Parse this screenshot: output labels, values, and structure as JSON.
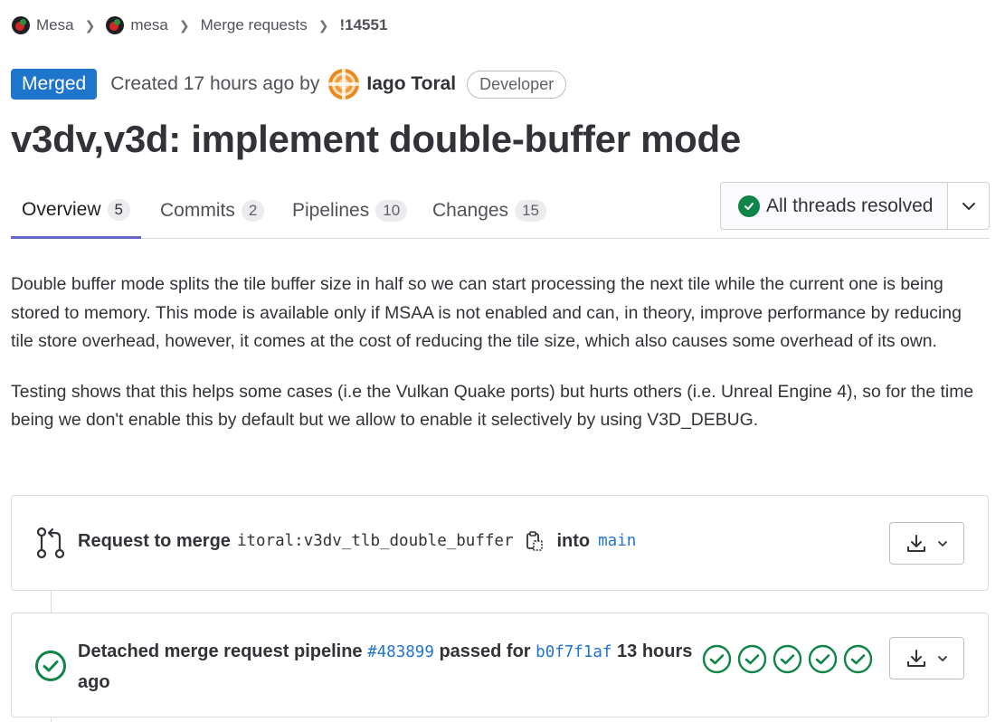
{
  "breadcrumb": {
    "items": [
      "Mesa",
      "mesa",
      "Merge requests"
    ],
    "current": "!14551"
  },
  "header": {
    "status": "Merged",
    "created_text": "Created 17 hours ago by",
    "author": "Iago Toral",
    "role": "Developer"
  },
  "title": "v3dv,v3d: implement double-buffer mode",
  "tabs": [
    {
      "label": "Overview",
      "count": "5"
    },
    {
      "label": "Commits",
      "count": "2"
    },
    {
      "label": "Pipelines",
      "count": "10"
    },
    {
      "label": "Changes",
      "count": "15"
    }
  ],
  "threads": {
    "label": "All threads resolved"
  },
  "description": {
    "p1": "Double buffer mode splits the tile buffer size in half so we can start processing the next tile while the current one is being stored to memory. This mode is available only if MSAA is not enabled and can, in theory, improve performance by reducing tile store overhead, however, it comes at the cost of reducing the tile size, which also causes some overhead of its own.",
    "p2": "Testing shows that this helps some cases (i.e the Vulkan Quake ports) but hurts others (i.e. Unreal Engine 4), so for the time being we don't enable this by default but we allow to enable it selectively by using V3D_DEBUG."
  },
  "merge_widget": {
    "prefix": "Request to merge",
    "source_owner": "itoral",
    "source_branch": ":v3dv_tlb_double_buffer",
    "into": "into",
    "target_branch": "main"
  },
  "pipeline_widget": {
    "text1": "Detached merge request pipeline",
    "pipeline_id": "#483899",
    "text2": "passed for",
    "commit": "b0f7f1af",
    "time": "13 hours ago",
    "stages": [
      "passed",
      "passed",
      "passed",
      "passed",
      "passed"
    ]
  },
  "colors": {
    "accent": "#1f75cb",
    "success": "#108548",
    "tab_underline": "#6666c4"
  }
}
